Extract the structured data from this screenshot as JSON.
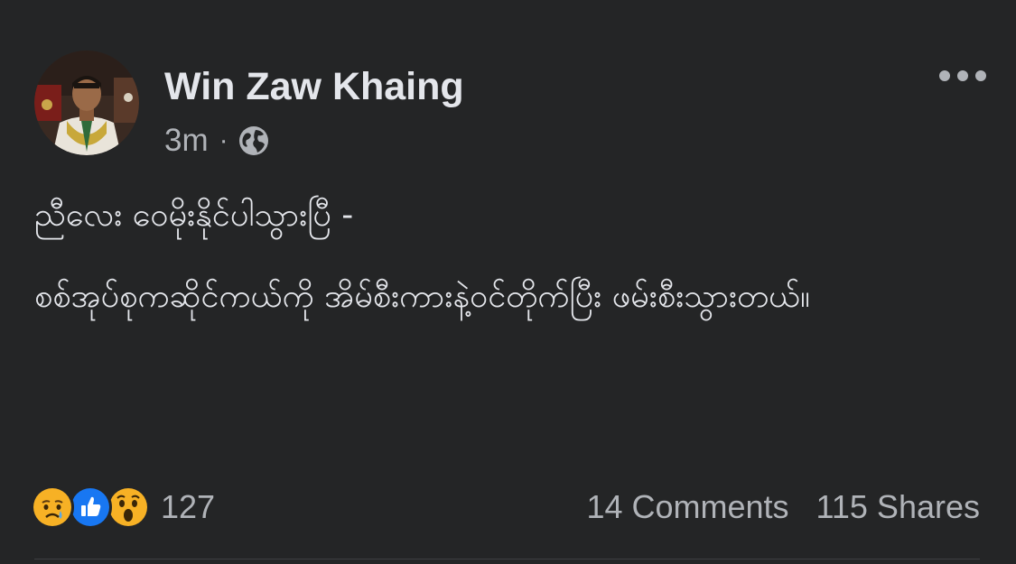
{
  "post": {
    "author_name": "Win Zaw Khaing",
    "timestamp": "3m",
    "separator": "·",
    "privacy_icon": "globe-icon",
    "more_icon": "more-options-icon",
    "text_paragraphs": [
      "ညီလေး ဝေမိုးနိုင်ပါသွားပြီ -",
      "စစ်အုပ်စုကဆိုင်ကယ်ကို အိမ်စီးကားနဲ့ဝင်တိုက်ပြီး ဖမ်းစီးသွားတယ်။"
    ]
  },
  "engagement": {
    "reaction_icons": [
      "sad-reaction-icon",
      "like-reaction-icon",
      "wow-reaction-icon"
    ],
    "reaction_count": "127",
    "comments": "14 Comments",
    "shares": "115 Shares"
  },
  "colors": {
    "background": "#242526",
    "primary_text": "#e4e6eb",
    "secondary_text": "#b0b3b8",
    "like_blue": "#1877f2",
    "reaction_yellow": "#f7b125"
  }
}
